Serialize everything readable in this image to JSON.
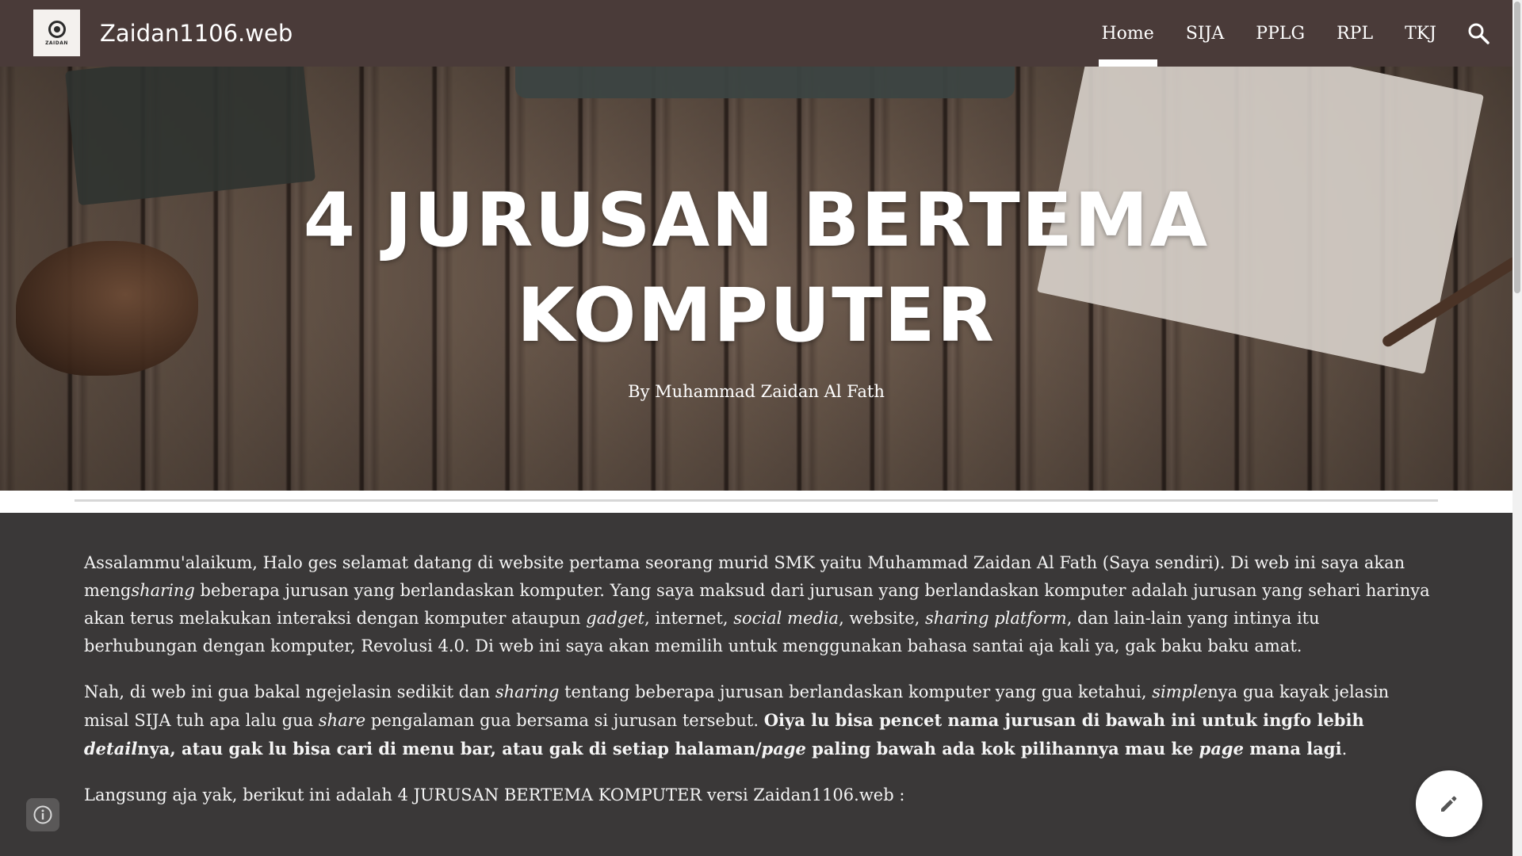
{
  "header": {
    "logo_text": "ZAIDAN",
    "site_title": "Zaidan1106.web",
    "nav": [
      {
        "label": "Home",
        "active": true
      },
      {
        "label": "SIJA",
        "active": false
      },
      {
        "label": "PPLG",
        "active": false
      },
      {
        "label": "RPL",
        "active": false
      },
      {
        "label": "TKJ",
        "active": false
      }
    ],
    "search_icon": "search-icon"
  },
  "hero": {
    "title_line1": "4 JURUSAN BERTEMA",
    "title_line2": "KOMPUTER",
    "byline": "By Muhammad Zaidan Al Fath"
  },
  "content": {
    "p1": {
      "t1": "Assalammu'alaikum, Halo ges selamat datang di website pertama seorang murid SMK yaitu Muhammad Zaidan Al Fath (Saya sendiri). Di web ini saya akan meng",
      "i1": "sharing",
      "t2": " beberapa jurusan yang berlandaskan komputer. Yang saya maksud dari jurusan yang berlandaskan komputer adalah jurusan yang sehari harinya akan terus melakukan interaksi dengan komputer ataupun ",
      "i2": "gadget",
      "t3": ", internet, ",
      "i3": "social media",
      "t4": ", website, ",
      "i4": "sharing platform",
      "t5": ", dan lain-lain yang intinya itu berhubungan dengan komputer, Revolusi 4.0. Di web ini saya akan memilih untuk menggunakan bahasa santai aja kali ya, gak baku baku amat."
    },
    "p2": {
      "t1": "Nah, di web ini gua bakal ngejelasin sedikit dan ",
      "i1": "sharing",
      "t2": " tentang beberapa jurusan berlandaskan komputer yang gua ketahui, ",
      "i2": "simple",
      "t3": "nya gua kayak jelasin misal SIJA tuh apa lalu gua ",
      "i3": "share",
      "t4": " pengalaman gua bersama si jurusan tersebut. ",
      "b1": "Oiya lu bisa pencet nama jurusan di bawah ini untuk ingfo lebih ",
      "bi1": "detail",
      "b2": "nya, atau gak lu bisa cari di menu bar, atau gak di setiap halaman/",
      "bi2": "page",
      "b3": " paling bawah ada kok pilihannya mau ke ",
      "bi3": "page",
      "b4": " mana lagi",
      "t5": "."
    },
    "p3": "Langsung aja yak, berikut ini adalah 4 JURUSAN BERTEMA KOMPUTER versi Zaidan1106.web :"
  },
  "controls": {
    "info_icon": "info-icon",
    "edit_icon": "pencil-icon"
  }
}
